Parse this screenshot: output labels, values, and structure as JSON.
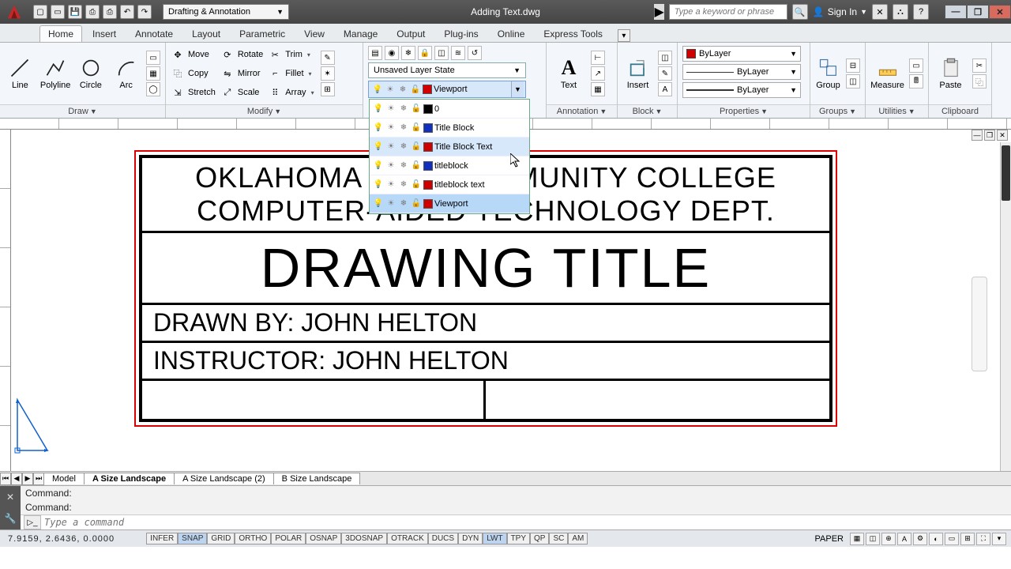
{
  "titlebar": {
    "workspace": "Drafting & Annotation",
    "document": "Adding Text.dwg",
    "search_placeholder": "Type a keyword or phrase",
    "signin": "Sign In"
  },
  "tabs": {
    "items": [
      "Home",
      "Insert",
      "Annotate",
      "Layout",
      "Parametric",
      "View",
      "Manage",
      "Output",
      "Plug-ins",
      "Online",
      "Express Tools"
    ],
    "active": 0
  },
  "ribbon": {
    "draw": {
      "title": "Draw",
      "line": "Line",
      "polyline": "Polyline",
      "circle": "Circle",
      "arc": "Arc"
    },
    "modify": {
      "title": "Modify",
      "move": "Move",
      "copy": "Copy",
      "stretch": "Stretch",
      "rotate": "Rotate",
      "mirror": "Mirror",
      "scale": "Scale",
      "trim": "Trim",
      "fillet": "Fillet",
      "array": "Array"
    },
    "layers": {
      "state": "Unsaved Layer State",
      "current": "Viewport"
    },
    "annotation": {
      "title": "Annotation",
      "text": "Text"
    },
    "block": {
      "title": "Block",
      "insert": "Insert"
    },
    "properties": {
      "title": "Properties",
      "bylayer": "ByLayer"
    },
    "groups": {
      "title": "Groups",
      "group": "Group"
    },
    "utilities": {
      "title": "Utilities",
      "measure": "Measure"
    },
    "clipboard": {
      "title": "Clipboard",
      "paste": "Paste"
    }
  },
  "layer_dropdown": [
    {
      "name": "Viewport",
      "color": "#d00000",
      "current": true
    },
    {
      "name": "0",
      "color": "#000000"
    },
    {
      "name": "Title Block",
      "color": "#1030c0"
    },
    {
      "name": "Title Block Text",
      "color": "#d00000",
      "hover": true
    },
    {
      "name": "titleblock",
      "color": "#1030c0"
    },
    {
      "name": "titleblock text",
      "color": "#d00000"
    },
    {
      "name": "Viewport",
      "color": "#d00000",
      "selected": true
    }
  ],
  "drawing": {
    "org1": "OKLAHOMA CITY COMMUNITY COLLEGE",
    "org2": "COMPUTER-AIDED TECHNOLOGY DEPT.",
    "title": "DRAWING TITLE",
    "drawn": "DRAWN BY: JOHN HELTON",
    "instructor": "INSTRUCTOR: JOHN HELTON"
  },
  "layouts": [
    "Model",
    "A Size Landscape",
    "A Size Landscape (2)",
    "B Size Landscape"
  ],
  "cmd": {
    "hist": "Command:",
    "placeholder": "Type a command"
  },
  "status": {
    "coords": "7.9159, 2.6436, 0.0000",
    "toggles": [
      "INFER",
      "SNAP",
      "GRID",
      "ORTHO",
      "POLAR",
      "OSNAP",
      "3DOSNAP",
      "OTRACK",
      "DUCS",
      "DYN",
      "LWT",
      "TPY",
      "QP",
      "SC",
      "AM"
    ],
    "toggles_on": [
      1,
      10
    ],
    "space": "PAPER"
  }
}
